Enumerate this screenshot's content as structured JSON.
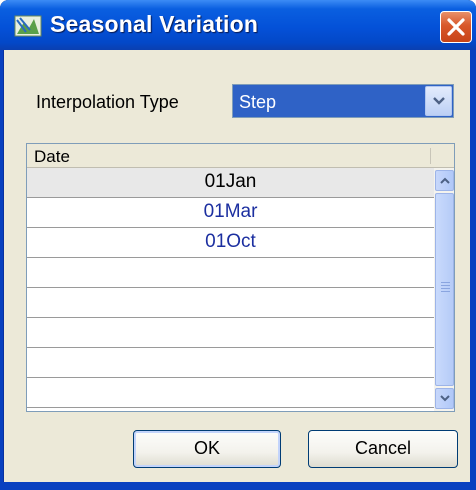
{
  "window": {
    "title": "Seasonal Variation",
    "icon": "app-icon",
    "close_icon": "close-icon"
  },
  "interpolation": {
    "label": "Interpolation Type",
    "selected": "Step"
  },
  "table": {
    "columns": [
      "Date"
    ],
    "rows": [
      "01Jan",
      "01Mar",
      "01Oct",
      "",
      "",
      "",
      "",
      ""
    ],
    "selected_row": 0
  },
  "buttons": {
    "ok": "OK",
    "cancel": "Cancel"
  },
  "colors": {
    "titlebar": "#0451d8",
    "selection": "#2f62c6",
    "date_text": "#1c2fa0"
  }
}
